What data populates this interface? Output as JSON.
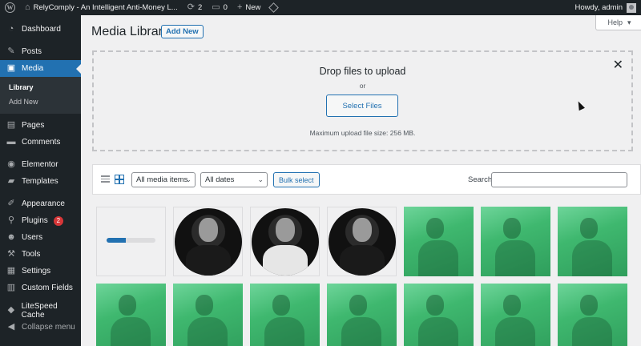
{
  "adminbar": {
    "site_name": "RelyComply - An Intelligent Anti-Money L...",
    "updates_count": "2",
    "comments_count": "0",
    "new_label": "New",
    "howdy": "Howdy, admin"
  },
  "sidebar": {
    "items": [
      {
        "label": "Dashboard",
        "icon": "dashboard-icon"
      },
      {
        "label": "Posts",
        "icon": "pin-icon"
      },
      {
        "label": "Media",
        "icon": "media-icon",
        "active": true
      },
      {
        "label": "Pages",
        "icon": "pages-icon"
      },
      {
        "label": "Comments",
        "icon": "comments-icon"
      },
      {
        "label": "Elementor",
        "icon": "elementor-icon"
      },
      {
        "label": "Templates",
        "icon": "folder-icon"
      },
      {
        "label": "Appearance",
        "icon": "brush-icon"
      },
      {
        "label": "Plugins",
        "icon": "plugin-icon",
        "badge": "2"
      },
      {
        "label": "Users",
        "icon": "users-icon"
      },
      {
        "label": "Tools",
        "icon": "wrench-icon"
      },
      {
        "label": "Settings",
        "icon": "settings-icon"
      },
      {
        "label": "Custom Fields",
        "icon": "fields-icon"
      },
      {
        "label": "LiteSpeed Cache",
        "icon": "litespeed-icon"
      }
    ],
    "media_submenu": [
      "Library",
      "Add New"
    ],
    "collapse_label": "Collapse menu"
  },
  "header": {
    "title": "Media Library",
    "add_new": "Add New",
    "help": "Help"
  },
  "uploader": {
    "title": "Drop files to upload",
    "or": "or",
    "button": "Select Files",
    "max_size": "Maximum upload file size: 256 MB."
  },
  "toolbar": {
    "media_filter": "All media items",
    "date_filter": "All dates",
    "bulk_select": "Bulk select",
    "search_label": "Search",
    "search_value": ""
  },
  "grid": {
    "upload_progress": 0.4,
    "tiles": [
      "uploading",
      "portrait",
      "portrait-light",
      "portrait",
      "photo",
      "photo",
      "photo",
      "photo",
      "photo",
      "photo",
      "photo",
      "photo",
      "photo",
      "photo"
    ]
  },
  "colors": {
    "accent": "#2271b1",
    "admin_dark": "#1d2327",
    "photo_tint": "#3fb86f",
    "badge": "#d63638"
  }
}
